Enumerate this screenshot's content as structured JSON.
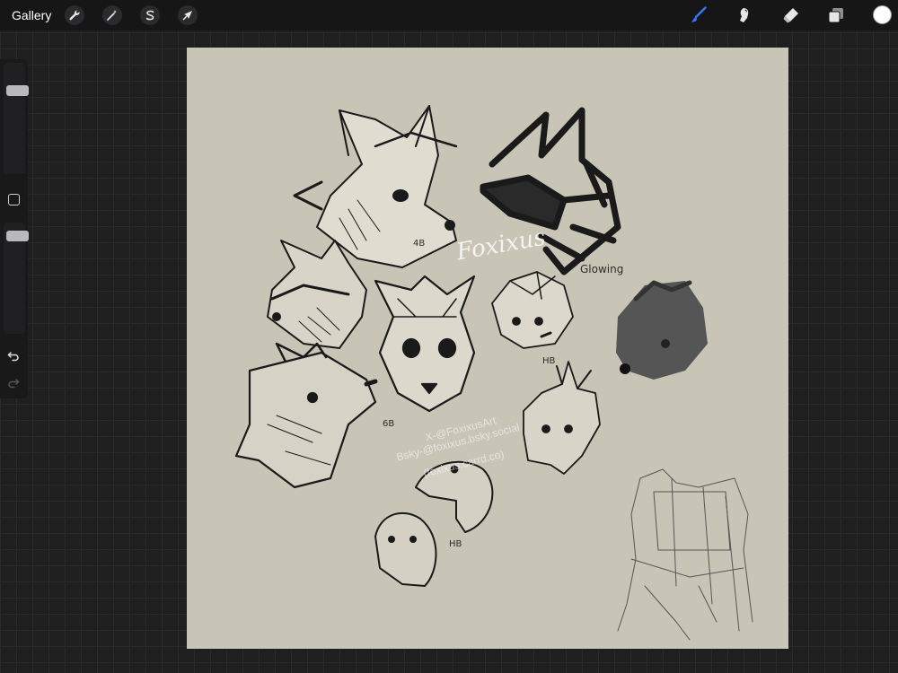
{
  "topbar": {
    "gallery_label": "Gallery",
    "left_tools": [
      {
        "name": "actions",
        "icon": "wrench-icon"
      },
      {
        "name": "adjustments",
        "icon": "magic-wand-icon"
      },
      {
        "name": "selection",
        "icon": "selection-s-icon"
      },
      {
        "name": "transform",
        "icon": "arrow-cursor-icon"
      }
    ],
    "right_tools": [
      {
        "name": "brush",
        "icon": "brush-icon",
        "active": true
      },
      {
        "name": "smudge",
        "icon": "smudge-finger-icon"
      },
      {
        "name": "eraser",
        "icon": "eraser-icon"
      },
      {
        "name": "layers",
        "icon": "layers-icon"
      }
    ],
    "current_color": "#ffffff",
    "accent_color": "#2f7bf5"
  },
  "sidebar": {
    "brush_size_level": 0.8,
    "opacity_level": 0.95,
    "icons": [
      "modify-square-icon",
      "undo-icon",
      "redo-icon"
    ]
  },
  "canvas": {
    "background": "#c8c5b6",
    "annotations": {
      "label_4b_top": "4B",
      "label_glowing": "Glowing",
      "label_hb_right": "HB",
      "label_6b": "6B",
      "label_hb_snake": "HB"
    },
    "watermark": {
      "signature": "Foxixus",
      "line1": "X-@FoxixusArt",
      "line2": "Bsky-@foxixus.bsky.social",
      "line3": "(foxixus.carrd.co)"
    }
  }
}
